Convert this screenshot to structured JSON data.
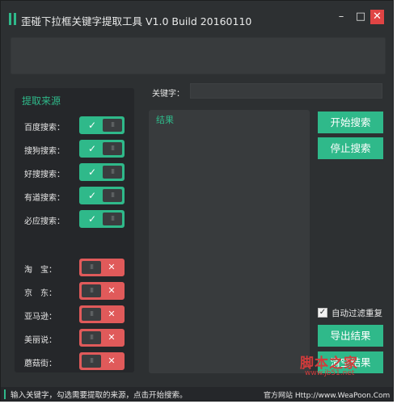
{
  "window": {
    "title": "歪碰下拉框关键字提取工具 V1.0 Build 20160110",
    "controls": {
      "minimize": "–",
      "maximize": "□",
      "close": "✕"
    }
  },
  "source": {
    "title": "提取来源",
    "on_symbol": "✓",
    "off_symbol": "✕",
    "knob_symbol": "III",
    "items": [
      {
        "label": "百度搜索：",
        "enabled": true
      },
      {
        "label": "搜狗搜索：",
        "enabled": true
      },
      {
        "label": "好搜搜索：",
        "enabled": true
      },
      {
        "label": "有道搜索：",
        "enabled": true
      },
      {
        "label": "必应搜索：",
        "enabled": true
      },
      {
        "label": "淘　宝：",
        "enabled": false
      },
      {
        "label": "京　东：",
        "enabled": false
      },
      {
        "label": "亚马逊：",
        "enabled": false
      },
      {
        "label": "美丽说：",
        "enabled": false
      },
      {
        "label": "蘑菇街：",
        "enabled": false
      }
    ]
  },
  "search": {
    "keyword_label": "关键字：",
    "keyword_value": ""
  },
  "results": {
    "label": "结果"
  },
  "actions": {
    "start": "开始搜索",
    "stop": "停止搜索",
    "auto_filter_label": "自动过滤重复",
    "auto_filter_checked": true,
    "auto_filter_check_symbol": "✓",
    "export": "导出结果",
    "clear": "清空结果"
  },
  "watermark": {
    "main": "脚本之家",
    "sub": "www.jb51.net"
  },
  "status": {
    "message": "输入关键字，勾选需要提取的来源，点击开始搜索。",
    "site": "官方网站 Http://www.WeaPoon.Com"
  },
  "colors": {
    "accent": "#2fb98a",
    "off": "#e05a5a",
    "bg": "#2d3032"
  }
}
